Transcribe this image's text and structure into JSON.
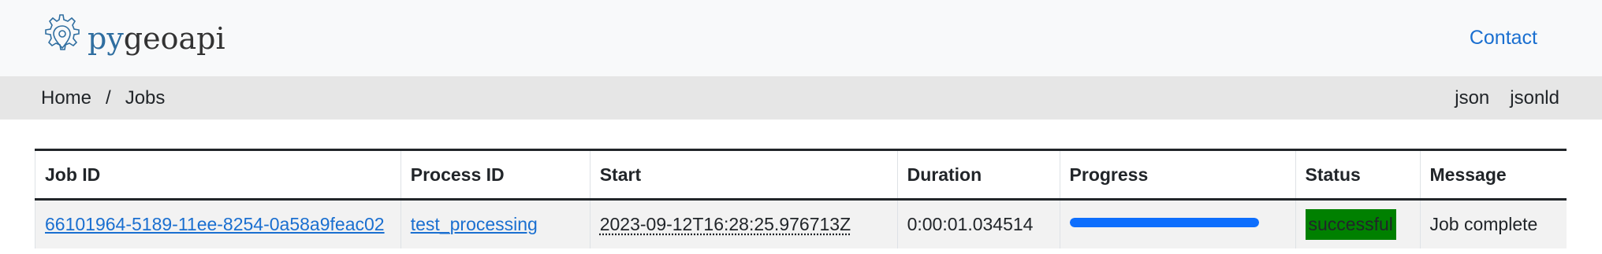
{
  "brand": {
    "name_prefix": "py",
    "name_suffix": "geoapi",
    "logo_icon": "gear-location-icon"
  },
  "nav": {
    "contact_label": "Contact"
  },
  "breadcrumb": {
    "home_label": "Home",
    "separator": "/",
    "current_label": "Jobs"
  },
  "formats": {
    "json_label": "json",
    "jsonld_label": "jsonld"
  },
  "table": {
    "headers": {
      "job_id": "Job ID",
      "process_id": "Process ID",
      "start": "Start",
      "duration": "Duration",
      "progress": "Progress",
      "status": "Status",
      "message": "Message"
    },
    "rows": [
      {
        "job_id": "66101964-5189-11ee-8254-0a58a9feac02",
        "process_id": "test_processing",
        "start": "2023-09-12T16:28:25.976713Z",
        "duration": "0:00:01.034514",
        "progress": 1.0,
        "status": "successful",
        "message": "Job complete"
      }
    ]
  },
  "colors": {
    "link": "#1a6fd0",
    "progress_bar": "#0d6efd",
    "status_success": "#008000",
    "navbar_bg": "#f8f9fa",
    "crumbbar_bg": "#e6e6e6"
  }
}
